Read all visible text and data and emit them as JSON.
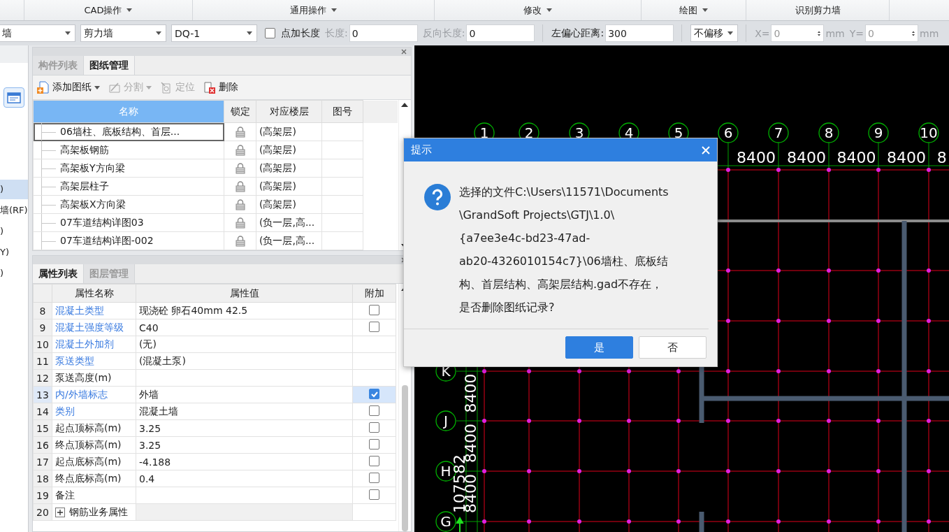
{
  "ribbon": {
    "groups": [
      {
        "label": "CAD操作",
        "dropdown": true
      },
      {
        "label": "通用操作",
        "dropdown": true
      },
      {
        "label": "修改",
        "dropdown": true
      },
      {
        "label": "绘图",
        "dropdown": true
      },
      {
        "label": "识别剪力墙",
        "dropdown": false
      }
    ]
  },
  "toolbar": [
    {
      "kind": "combo",
      "value": "墙"
    },
    {
      "kind": "combo",
      "value": "剪力墙"
    },
    {
      "kind": "combo",
      "value": "DQ-1"
    },
    {
      "kind": "checkbox",
      "label": "点加长度",
      "checked": false
    },
    {
      "kind": "field",
      "label": "长度:",
      "value": "0",
      "disabled": true
    },
    {
      "kind": "field",
      "label": "反向长度:",
      "value": "0",
      "disabled": true
    },
    {
      "kind": "field",
      "label": "左偏心距离:",
      "value": "300",
      "disabled": false
    },
    {
      "kind": "combo",
      "value": "不偏移"
    },
    {
      "kind": "spin",
      "label": "X=",
      "value": "0",
      "unit": "mm",
      "disabled": true
    },
    {
      "kind": "spin",
      "label": "Y=",
      "value": "0",
      "unit": "mm",
      "disabled": true
    }
  ],
  "left_strip": {
    "items": [
      {
        "label": ")",
        "selected": true
      },
      {
        "label": "墙(RF)",
        "selected": false
      },
      {
        "label": ")",
        "selected": false
      },
      {
        "label": "Y)",
        "selected": false
      },
      {
        "label": ")",
        "selected": false
      }
    ]
  },
  "drawing_panel": {
    "tabs": [
      {
        "label": "构件列表",
        "selected": false
      },
      {
        "label": "图纸管理",
        "selected": true
      }
    ],
    "tools": [
      {
        "label": "添加图纸",
        "kind": "add",
        "dropdown": true,
        "disabled": false
      },
      {
        "label": "分割",
        "kind": "split",
        "dropdown": true,
        "disabled": true
      },
      {
        "label": "定位",
        "kind": "locate",
        "dropdown": false,
        "disabled": true
      },
      {
        "label": "删除",
        "kind": "delete",
        "dropdown": false,
        "disabled": false
      }
    ],
    "table": {
      "columns": [
        "名称",
        "锁定",
        "对应楼层",
        "图号"
      ],
      "rows": [
        {
          "name": "06墙柱、底板结构、首层...",
          "locked": true,
          "floor": "(高架层)",
          "selected": true
        },
        {
          "name": "高架板钢筋",
          "locked": true,
          "floor": "(高架层)",
          "selected": false
        },
        {
          "name": "高架板Y方向梁",
          "locked": true,
          "floor": "(高架层)",
          "selected": false
        },
        {
          "name": "高架层柱子",
          "locked": true,
          "floor": "(高架层)",
          "selected": false
        },
        {
          "name": "高架板X方向梁",
          "locked": true,
          "floor": "(高架层)",
          "selected": false
        },
        {
          "name": "07车道结构详图03",
          "locked": true,
          "floor": "(负一层,高...",
          "selected": false
        },
        {
          "name": "07车道结构详图-002",
          "locked": true,
          "floor": "(负一层,高...",
          "selected": false
        }
      ]
    }
  },
  "properties_panel": {
    "tabs": [
      {
        "label": "属性列表",
        "selected": true
      },
      {
        "label": "图层管理",
        "selected": false
      }
    ],
    "table": {
      "columns": [
        "属性名称",
        "属性值",
        "附加"
      ],
      "rows": [
        {
          "kind": "property",
          "index": "8",
          "name": "混凝土类型",
          "public": true,
          "value": "现浇砼 卵石40mm 42.5",
          "attach": false,
          "selected": false
        },
        {
          "kind": "property",
          "index": "9",
          "name": "混凝土强度等级",
          "public": true,
          "value": "C40",
          "attach": false,
          "selected": false
        },
        {
          "kind": "property",
          "index": "10",
          "name": "混凝土外加剂",
          "public": true,
          "value": "(无)",
          "selected": false
        },
        {
          "kind": "property",
          "index": "11",
          "name": "泵送类型",
          "public": true,
          "value": "(混凝土泵)",
          "selected": false
        },
        {
          "kind": "property",
          "index": "12",
          "name": "泵送高度(m)",
          "public": false,
          "selected": false
        },
        {
          "kind": "property",
          "index": "13",
          "name": "内/外墙标志",
          "public": true,
          "value": "外墙",
          "attach": true,
          "selected": true
        },
        {
          "kind": "property",
          "index": "14",
          "name": "类别",
          "public": true,
          "value": "混凝土墙",
          "attach": false,
          "selected": false
        },
        {
          "kind": "property",
          "index": "15",
          "name": "起点顶标高(m)",
          "public": false,
          "value": "3.25",
          "attach": false,
          "selected": false
        },
        {
          "kind": "property",
          "index": "16",
          "name": "终点顶标高(m)",
          "public": false,
          "value": "3.25",
          "attach": false,
          "selected": false
        },
        {
          "kind": "property",
          "index": "17",
          "name": "起点底标高(m)",
          "public": false,
          "value": "-4.188",
          "attach": false,
          "selected": false
        },
        {
          "kind": "property",
          "index": "18",
          "name": "终点底标高(m)",
          "public": false,
          "value": "0.4",
          "attach": false,
          "selected": false
        },
        {
          "kind": "property",
          "index": "19",
          "name": "备注",
          "public": false,
          "attach": false,
          "selected": false
        },
        {
          "kind": "group",
          "index": "20",
          "name": "钢筋业务属性",
          "expanded": false,
          "selected": false
        }
      ]
    }
  },
  "canvas": {
    "column_axes": [
      "1",
      "2",
      "3",
      "4",
      "5",
      "6",
      "7",
      "8",
      "9",
      "10"
    ],
    "column_dims": [
      "8400",
      "8400",
      "8400",
      "8400",
      "8"
    ],
    "row_axes": [
      "K",
      "J",
      "H",
      "G"
    ],
    "row_dims": [
      "8400",
      "8400",
      "8400"
    ],
    "total_dim": "107582"
  },
  "dialog": {
    "title": "提示",
    "message_lines": [
      "选择的文件C:\\Users\\11571\\Documents",
      "\\GrandSoft Projects\\GTJ\\1.0\\",
      "{a7ee3e4c-bd23-47ad-",
      "ab20-4326010154c7}\\06墙柱、底板结",
      "构、首层结构、高架层结构.gad不存在，",
      "是否删除图纸记录?"
    ],
    "buttons": [
      {
        "label": "是",
        "primary": true
      },
      {
        "label": "否",
        "primary": false
      }
    ]
  }
}
